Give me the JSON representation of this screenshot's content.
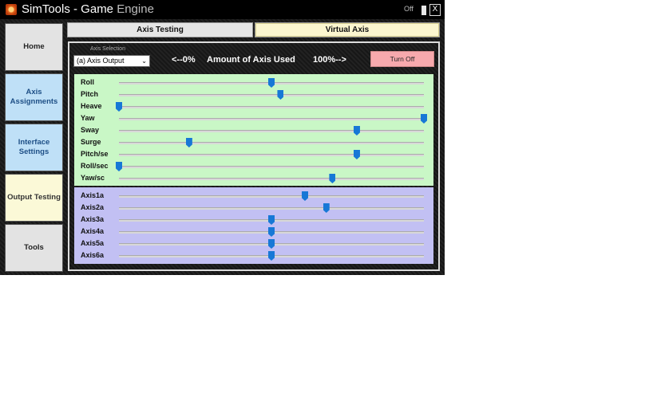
{
  "window": {
    "title_main": "SimTools - Game",
    "title_secondary": " Engine",
    "off_label": "Off",
    "close_label": "X"
  },
  "sidebar": {
    "items": [
      {
        "label": "Home"
      },
      {
        "label": "Axis Assignments"
      },
      {
        "label": "Interface Settings"
      },
      {
        "label": "Output Testing"
      },
      {
        "label": "Tools"
      }
    ]
  },
  "tabs": [
    {
      "label": "Axis Testing"
    },
    {
      "label": "Virtual Axis"
    }
  ],
  "controls": {
    "selection_label": "Axis Selection",
    "selection_value": "(a) Axis Output",
    "min_label": "<--0%",
    "amount_label": "Amount of Axis Used",
    "max_label": "100%-->",
    "turn_off_label": "Turn Off"
  },
  "dof_sliders": [
    {
      "label": "Roll",
      "value": 0.5
    },
    {
      "label": "Pitch",
      "value": 0.53
    },
    {
      "label": "Heave",
      "value": 0.0
    },
    {
      "label": "Yaw",
      "value": 1.0
    },
    {
      "label": "Sway",
      "value": 0.78
    },
    {
      "label": "Surge",
      "value": 0.23
    },
    {
      "label": "Pitch/se",
      "value": 0.78
    },
    {
      "label": "Roll/sec",
      "value": 0.0
    },
    {
      "label": "Yaw/sc",
      "value": 0.7
    }
  ],
  "axis_sliders": [
    {
      "label": "Axis1a",
      "value": 0.61
    },
    {
      "label": "Axis2a",
      "value": 0.68
    },
    {
      "label": "Axis3a",
      "value": 0.5
    },
    {
      "label": "Axis4a",
      "value": 0.5
    },
    {
      "label": "Axis5a",
      "value": 0.5
    },
    {
      "label": "Axis6a",
      "value": 0.5
    }
  ]
}
